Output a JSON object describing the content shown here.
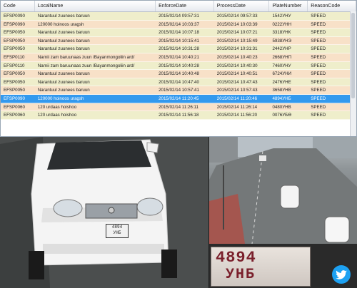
{
  "columns": [
    "Code",
    "LocalName",
    "EnforceDate",
    "ProcessDate",
    "PlateNumber",
    "ReasonCode"
  ],
  "rows": [
    [
      "EFSP0090",
      "Narantuul zuunees baruun",
      "2015/02/14 09:57:31",
      "2015/02/14 09:57:33",
      "1542УНУ",
      "SPEED"
    ],
    [
      "EFSP0090",
      "120000 hoinoos uragsh",
      "2015/02/14 10:03:37",
      "2015/02/14 10:03:39",
      "0222УНН",
      "SPEED"
    ],
    [
      "EFSP0050",
      "Narantuul zuunees baruun",
      "2015/02/14 10:07:18",
      "2015/02/14 10:07:21",
      "3318УНК",
      "SPEED"
    ],
    [
      "EFSP0050",
      "Narantuul zuunees baruun",
      "2015/02/14 10:15:41",
      "2015/02/14 10:15:49",
      "5938УНЭ",
      "SPEED"
    ],
    [
      "EFSP0050",
      "Narantuul zuunees baruun",
      "2015/02/14 10:31:28",
      "2015/02/14 10:31:31",
      "2442УНР",
      "SPEED"
    ],
    [
      "EFSP0110",
      "Narnii zam baruunaas zuun /Bayanmongoliin ard/",
      "2015/02/14 10:40:21",
      "2015/02/14 10:40:23",
      "2668УНП",
      "SPEED"
    ],
    [
      "EFSP0110",
      "Narnii zam baruunaas zuun /Bayanmongoliin ard/",
      "2015/02/14 10:40:28",
      "2015/02/14 10:40:30",
      "7460УНУ",
      "SPEED"
    ],
    [
      "EFSP0050",
      "Narantuul zuunees baruun",
      "2015/02/14 10:40:48",
      "2015/02/14 10:40:51",
      "6724УНИ",
      "SPEED"
    ],
    [
      "EFSP0050",
      "Narantuul zuunees baruun",
      "2015/02/14 10:47:40",
      "2015/02/14 10:47:43",
      "2476УНЕ",
      "SPEED"
    ],
    [
      "EFSP0050",
      "Narantuul zuunees baruun",
      "2015/02/14 10:57:41",
      "2015/02/14 10:57:43",
      "3658УНВ",
      "SPEED"
    ],
    [
      "EFSP0090",
      "120000 hoinoos uragsh",
      "2015/02/14 11:20:45",
      "2015/02/14 11:20:46",
      "4894УНБ",
      "SPEED"
    ],
    [
      "EFSP0060",
      "120 urdaas hoishoo",
      "2015/02/14 11:26:11",
      "2015/02/14 11:26:14",
      "0480УНВ",
      "SPEED"
    ],
    [
      "EFSP0060",
      "120 urdaas hoishoo",
      "2015/02/14 11:56:18",
      "2015/02/14 11:56:20",
      "0076УБӨ",
      "SPEED"
    ]
  ],
  "selected_row": 10,
  "plate_closeup": {
    "number": "4894",
    "letters": "УНБ"
  },
  "car_plate": {
    "line1": "4894",
    "line2": "УНБ"
  },
  "colors": {
    "row_odd": "#efeecb",
    "row_even": "#f8e1c8",
    "selected": "#3399ee",
    "twitter": "#1da1f2"
  },
  "icons": {
    "share": "twitter-bird-icon"
  }
}
